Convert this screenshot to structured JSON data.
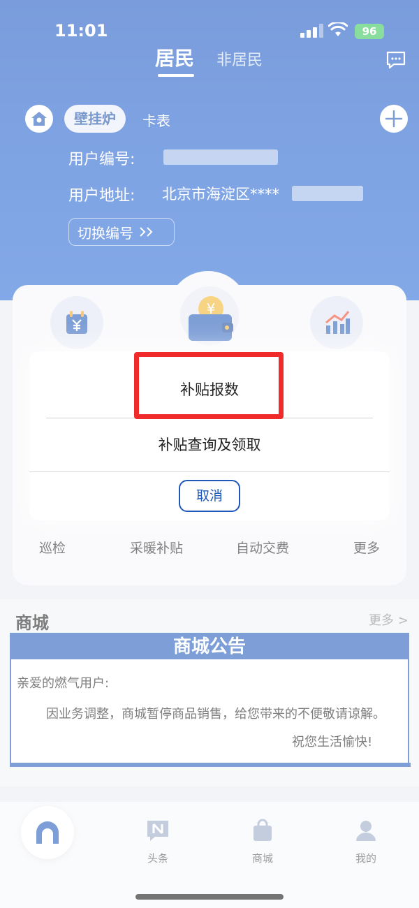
{
  "status": {
    "time": "11:01",
    "battery": "96"
  },
  "tabs": {
    "resident": "居民",
    "nonresident": "非居民"
  },
  "account": {
    "tag_boiler": "壁挂炉",
    "tag_card": "卡表",
    "user_number_label": "用户编号:",
    "user_address_label": "用户地址:",
    "user_address_value": "北京市海淀区****",
    "switch_label": "切换编号"
  },
  "services": [
    "巡检",
    "采暖补贴",
    "自动交费",
    "更多"
  ],
  "mall": {
    "title": "商城",
    "more": "更多 >",
    "notice_title": "商城公告",
    "greeting": "亲爱的燃气用户:",
    "body": "因业务调整，商城暂停商品销售，给您带来的不便敬请谅解。",
    "sign": "祝您生活愉快!"
  },
  "nav": {
    "headlines": "头条",
    "mall": "商城",
    "mine": "我的"
  },
  "modal": {
    "option_report": "补贴报数",
    "option_query": "补贴查询及领取",
    "cancel": "取消"
  },
  "colors": {
    "primary": "#1b55c2",
    "highlight": "#ef2b2b",
    "battery": "#35c759"
  }
}
